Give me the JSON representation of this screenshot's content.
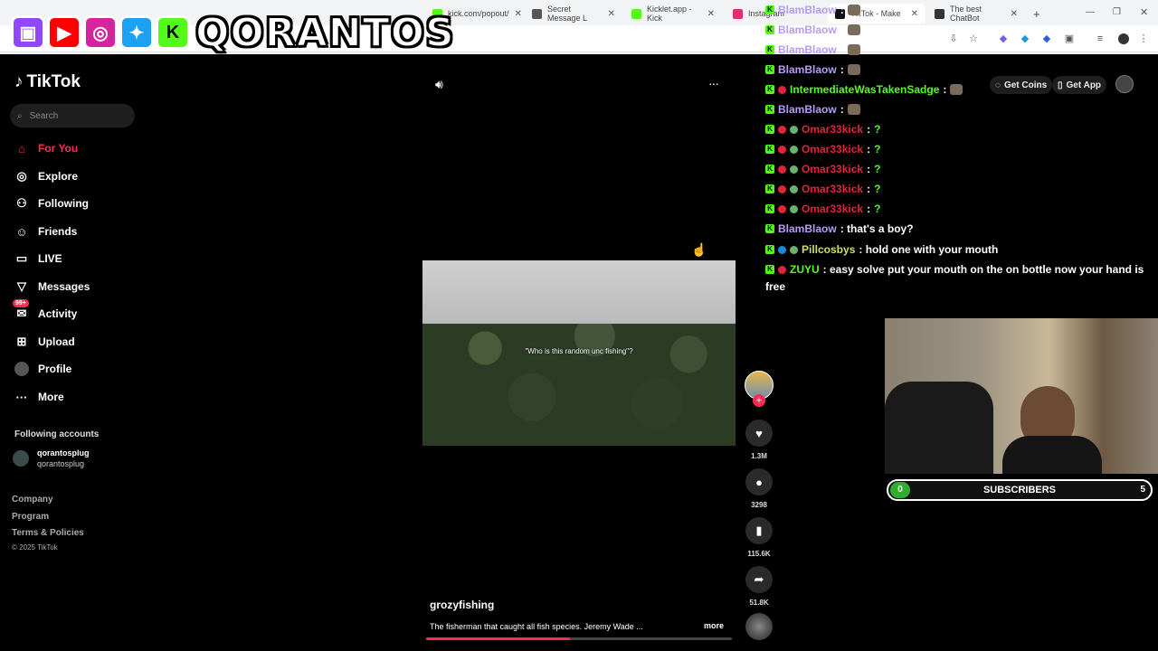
{
  "browser": {
    "tabs": [
      {
        "label": "kick.com/popout/",
        "color": "#53fc18"
      },
      {
        "label": "Secret Message L",
        "color": "#555555"
      },
      {
        "label": "Kicklet.app - Kick",
        "color": "#53fc18"
      },
      {
        "label": "Instagram",
        "color": "#e1306c"
      },
      {
        "label": "TikTok - Make",
        "color": "#111111"
      },
      {
        "label": "The best ChatBot",
        "color": "#333333"
      }
    ],
    "new_tab": "+"
  },
  "overlay": {
    "channel_name": "QORANTOS",
    "icons": [
      "twitch-logo",
      "youtube-logo",
      "instagram-logo",
      "twitter-logo",
      "kick-logo"
    ]
  },
  "tiktok": {
    "brand": "TikTok",
    "search_placeholder": "Search",
    "nav": [
      {
        "label": "For You",
        "icon": "home-icon",
        "active": true
      },
      {
        "label": "Explore",
        "icon": "compass-icon"
      },
      {
        "label": "Following",
        "icon": "following-icon"
      },
      {
        "label": "Friends",
        "icon": "friends-icon"
      },
      {
        "label": "LIVE",
        "icon": "live-icon"
      },
      {
        "label": "Messages",
        "icon": "messages-icon"
      },
      {
        "label": "Activity",
        "icon": "activity-icon",
        "badge": "99+"
      },
      {
        "label": "Upload",
        "icon": "upload-icon"
      },
      {
        "label": "Profile",
        "icon": "profile-icon"
      },
      {
        "label": "More",
        "icon": "more-icon"
      }
    ],
    "following_accounts_title": "Following accounts",
    "following_account": {
      "name": "qorantosplug",
      "handle": "qorantosplug"
    },
    "footer": [
      "Company",
      "Program",
      "Terms & Policies",
      "© 2025 TikTok"
    ],
    "video": {
      "caption": "\"Who is this random unc fishing\"?",
      "author": "grozyfishing",
      "description": "The fisherman that caught all fish species. Jeremy Wade ...",
      "more": "more",
      "progress": 0.47
    },
    "actions": {
      "likes": "1.3M",
      "comments": "3298",
      "saves": "115.6K",
      "shares": "51.8K"
    },
    "get_coins": "Get Coins",
    "get_app": "Get App"
  },
  "chat": [
    {
      "user": "BlamBlaow",
      "color": "#b69cf5",
      "text": ":",
      "emote": true
    },
    {
      "user": "BlamBlaow",
      "color": "#b69cf5",
      "text": ":",
      "emote": true
    },
    {
      "user": "BlamBlaow",
      "color": "#b69cf5",
      "text": ":",
      "emote": true
    },
    {
      "user": "BlamBlaow",
      "color": "#b69cf5",
      "text": ":",
      "emote": true
    },
    {
      "user": "IntermediateWasTakenSadge",
      "color": "#53fc18",
      "text": ":",
      "emote": true
    },
    {
      "user": "BlamBlaow",
      "color": "#b69cf5",
      "text": ":",
      "emote": true
    },
    {
      "user": "Omar33kick",
      "color": "#e0243a",
      "text": ":",
      "emote": "?"
    },
    {
      "user": "Omar33kick",
      "color": "#e0243a",
      "text": ":",
      "emote": "?"
    },
    {
      "user": "Omar33kick",
      "color": "#e0243a",
      "text": ":",
      "emote": "?"
    },
    {
      "user": "Omar33kick",
      "color": "#e0243a",
      "text": ":",
      "emote": "?"
    },
    {
      "user": "Omar33kick",
      "color": "#e0243a",
      "text": ":",
      "emote": "?"
    },
    {
      "user": "BlamBlaow",
      "color": "#b69cf5",
      "text": ": that's a boy?"
    },
    {
      "user": "Pillcosbys",
      "color": "#c8e06b",
      "text": ": hold one with your mouth"
    },
    {
      "user": "ZUYU",
      "color": "#53fc18",
      "text": ": easy solve put your mouth on the on bottle now your hand is"
    },
    {
      "user": "",
      "color": "#ffffff",
      "text": "free"
    }
  ],
  "subs_bar": {
    "label": "SUBSCRIBERS",
    "current": "0",
    "goal": "5"
  }
}
